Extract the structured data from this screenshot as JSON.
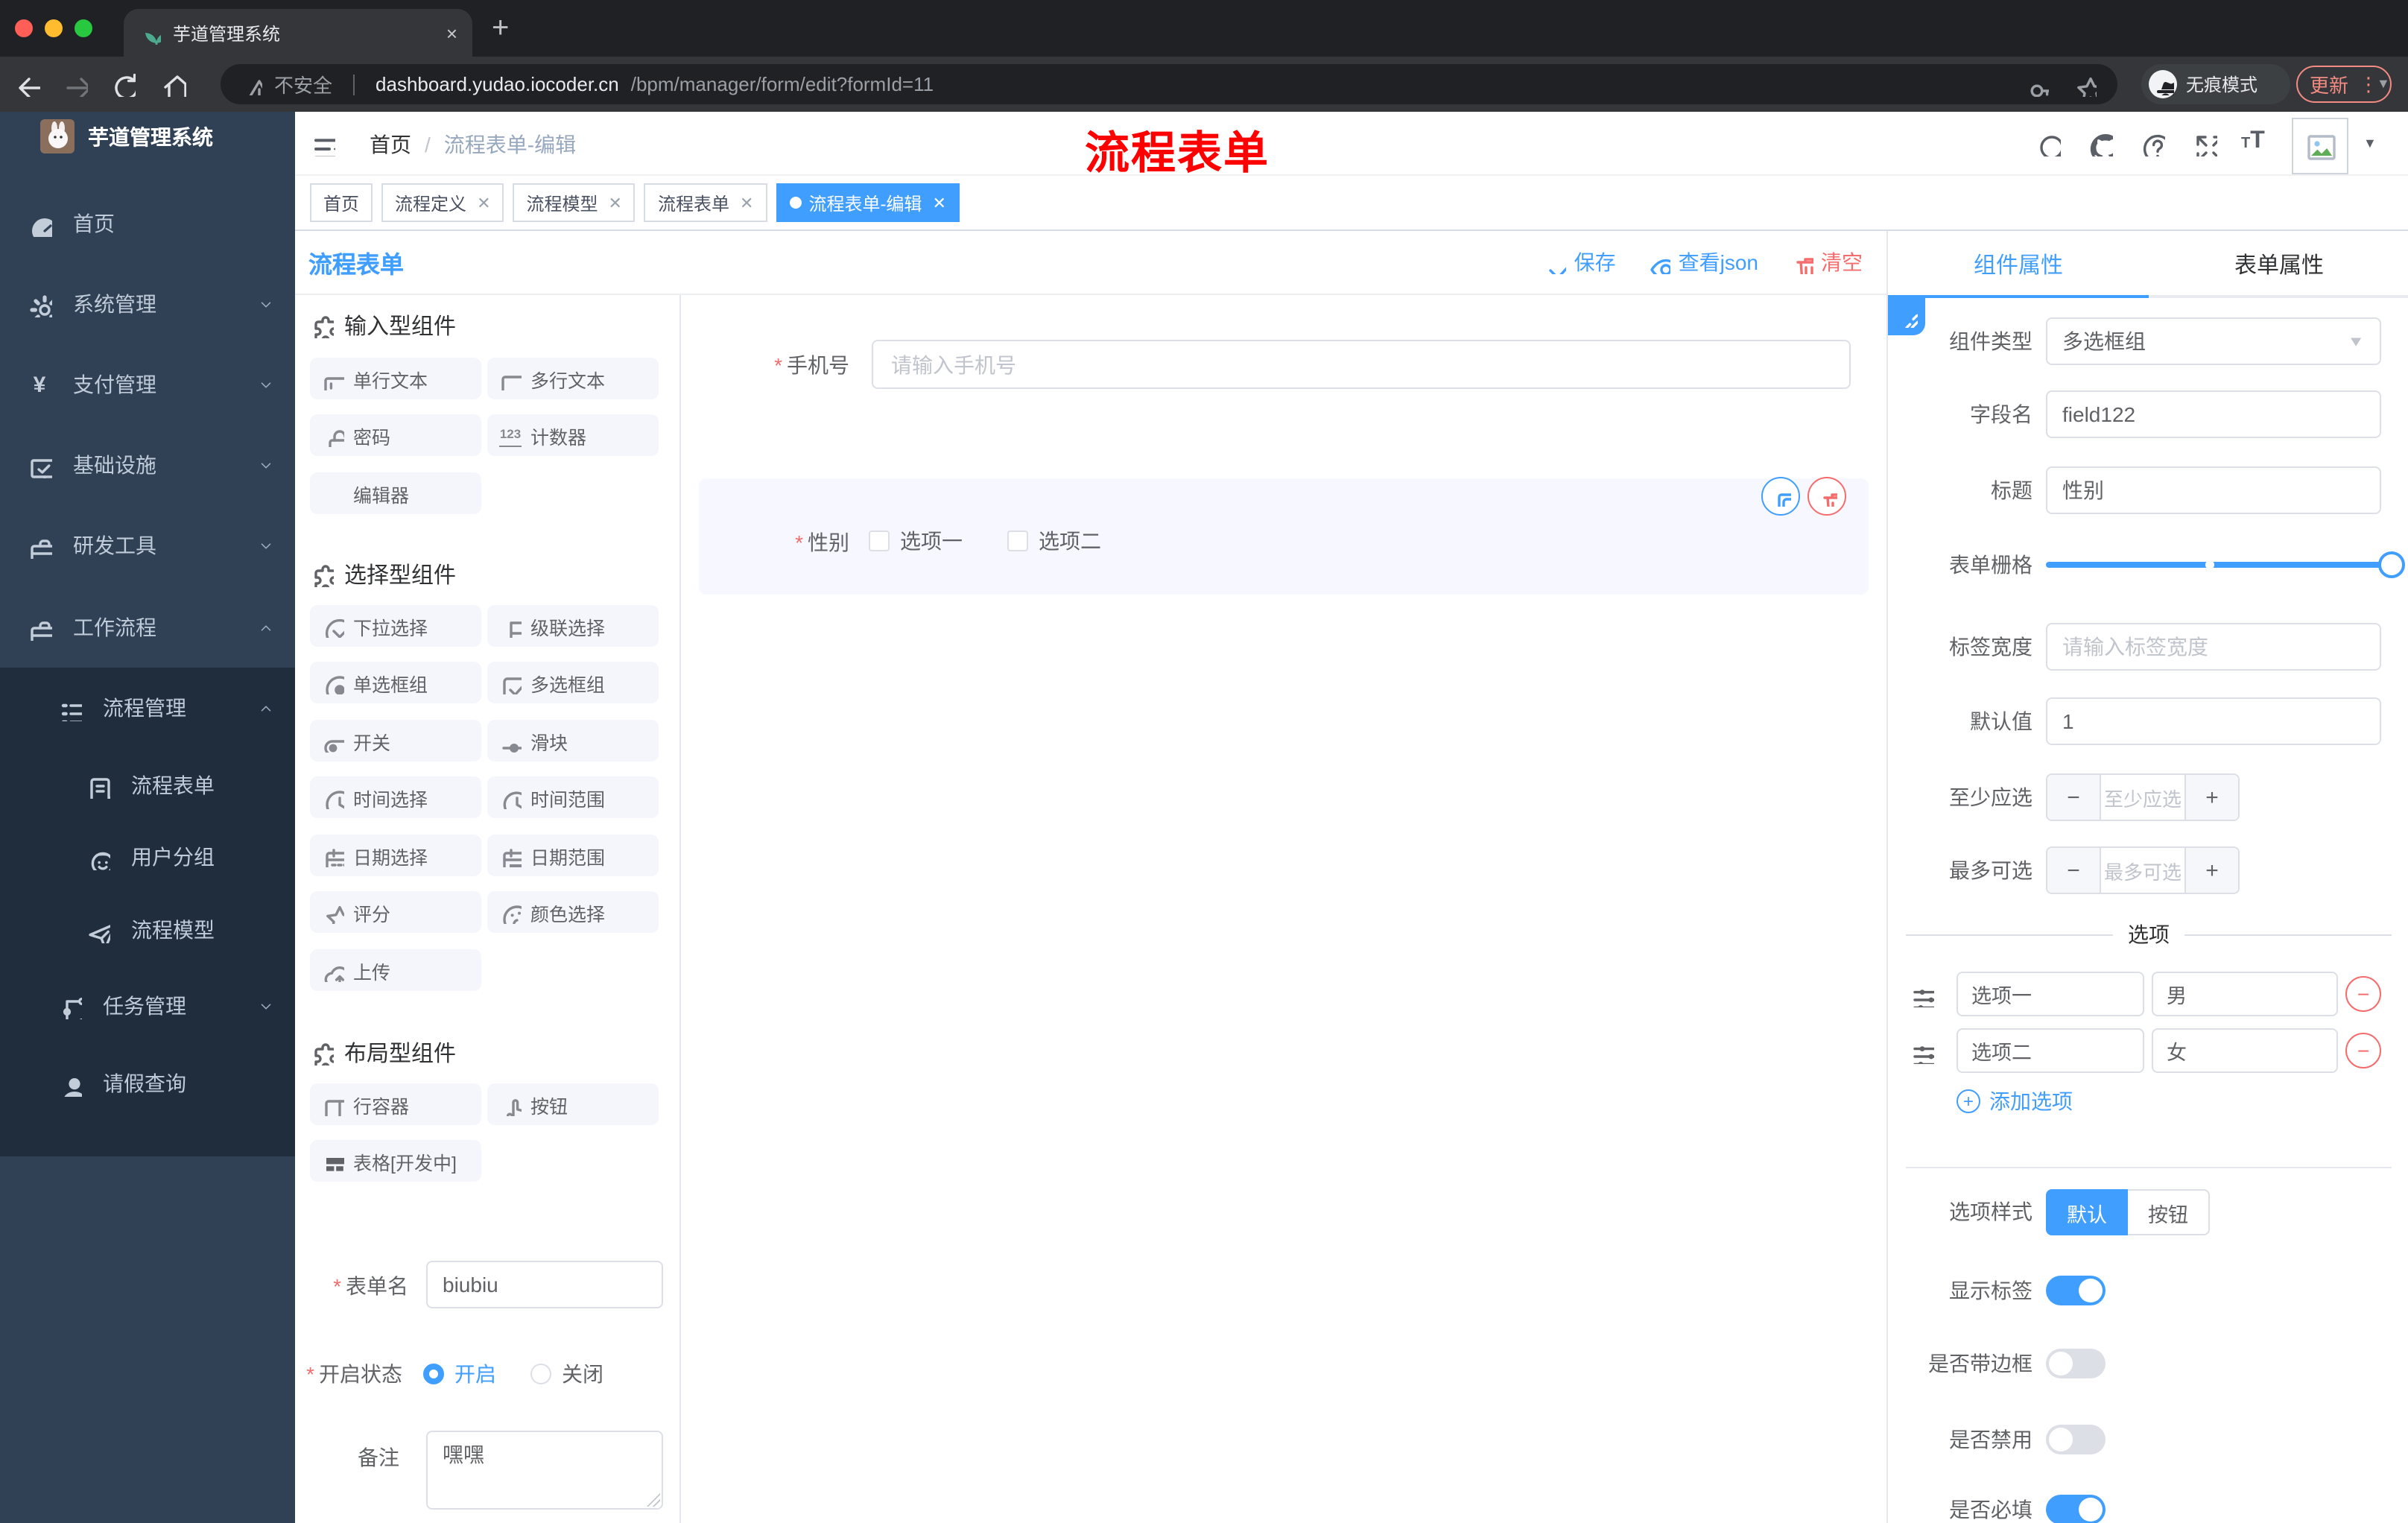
{
  "browser": {
    "tab_title": "芋道管理系统",
    "tab_close": "×",
    "new_tab": "+",
    "security_text": "不安全",
    "url_host": "dashboard.yudao.iocoder.cn",
    "url_path": "/bpm/manager/form/edit?formId=11",
    "incognito_label": "无痕模式",
    "update_label": "更新",
    "menu_dots": "⋮"
  },
  "sidebar": {
    "title": "芋道管理系统",
    "items": [
      {
        "label": "首页"
      },
      {
        "label": "系统管理"
      },
      {
        "label": "支付管理"
      },
      {
        "label": "基础设施"
      },
      {
        "label": "研发工具"
      },
      {
        "label": "工作流程"
      }
    ],
    "submenu": [
      {
        "label": "流程管理"
      },
      {
        "label": "流程表单"
      },
      {
        "label": "用户分组"
      },
      {
        "label": "流程模型"
      },
      {
        "label": "任务管理"
      },
      {
        "label": "请假查询"
      }
    ]
  },
  "navbar": {
    "breadcrumb": {
      "home": "首页",
      "sep": "/",
      "current": "流程表单-编辑"
    },
    "watermark": "流程表单"
  },
  "tags": [
    {
      "label": "首页"
    },
    {
      "label": "流程定义"
    },
    {
      "label": "流程模型"
    },
    {
      "label": "流程表单"
    },
    {
      "label": "流程表单-编辑"
    }
  ],
  "action_bar": {
    "title": "流程表单",
    "save": "保存",
    "view_json": "查看json",
    "clear": "清空"
  },
  "components_panel": {
    "sections": [
      {
        "title": "输入型组件",
        "items": [
          "单行文本",
          "多行文本",
          "密码",
          "计数器",
          "编辑器"
        ]
      },
      {
        "title": "选择型组件",
        "items": [
          "下拉选择",
          "级联选择",
          "单选框组",
          "多选框组",
          "开关",
          "滑块",
          "时间选择",
          "时间范围",
          "日期选择",
          "日期范围",
          "评分",
          "颜色选择",
          "上传"
        ]
      },
      {
        "title": "布局型组件",
        "items": [
          "行容器",
          "按钮",
          "表格[开发中]"
        ]
      }
    ],
    "counter_glyph": "123",
    "form": {
      "name_label": "表单名",
      "name_value": "biubiu",
      "status_label": "开启状态",
      "status_on": "开启",
      "status_off": "关闭",
      "remark_label": "备注",
      "remark_value": "嘿嘿"
    }
  },
  "canvas": {
    "phone": {
      "label": "手机号",
      "placeholder": "请输入手机号"
    },
    "gender": {
      "label": "性别",
      "option1": "选项一",
      "option2": "选项二"
    }
  },
  "props_panel": {
    "tab_component": "组件属性",
    "tab_form": "表单属性",
    "component_type": {
      "label": "组件类型",
      "value": "多选框组"
    },
    "field_name": {
      "label": "字段名",
      "value": "field122"
    },
    "title_field": {
      "label": "标题",
      "value": "性别"
    },
    "grid": {
      "label": "表单栅格"
    },
    "label_width": {
      "label": "标签宽度",
      "placeholder": "请输入标签宽度"
    },
    "default_value": {
      "label": "默认值",
      "value": "1"
    },
    "min_select": {
      "label": "至少应选",
      "placeholder": "至少应选"
    },
    "max_select": {
      "label": "最多可选",
      "placeholder": "最多可选"
    },
    "options": {
      "divider": "选项",
      "rows": [
        {
          "name": "选项一",
          "value": "男"
        },
        {
          "name": "选项二",
          "value": "女"
        }
      ],
      "add": "添加选项"
    },
    "option_style": {
      "label": "选项样式",
      "opt_default": "默认",
      "opt_button": "按钮"
    },
    "toggles": [
      {
        "label": "显示标签",
        "on": true
      },
      {
        "label": "是否带边框",
        "on": false
      },
      {
        "label": "是否禁用",
        "on": false
      },
      {
        "label": "是否必填",
        "on": true
      }
    ]
  },
  "colors": {
    "accent": "#409eff",
    "danger": "#f56c6c",
    "sidebar": "#304156",
    "sidebar_dark": "#1f2d3d",
    "watermark": "#ff0000"
  }
}
